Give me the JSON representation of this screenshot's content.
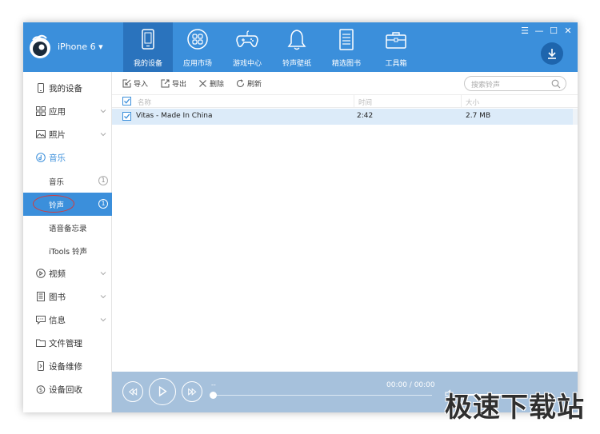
{
  "header": {
    "device_name": "iPhone 6 ▾",
    "tabs": [
      {
        "label": "我的设备",
        "icon": "phone-icon",
        "active": true
      },
      {
        "label": "应用市场",
        "icon": "apps-icon",
        "active": false
      },
      {
        "label": "游戏中心",
        "icon": "gamepad-icon",
        "active": false
      },
      {
        "label": "铃声壁纸",
        "icon": "bell-icon",
        "active": false
      },
      {
        "label": "精选图书",
        "icon": "book-icon",
        "active": false
      },
      {
        "label": "工具箱",
        "icon": "toolbox-icon",
        "active": false
      }
    ],
    "window_controls": [
      "☰",
      "—",
      "☐",
      "✕"
    ],
    "accent": "#3b8fdb",
    "active_tab_bg": "#2a73bd"
  },
  "sidebar": {
    "items": [
      {
        "label": "我的设备",
        "icon": "device-icon"
      },
      {
        "label": "应用",
        "icon": "grid-icon",
        "expandable": true
      },
      {
        "label": "照片",
        "icon": "photo-icon",
        "expandable": true
      },
      {
        "label": "音乐",
        "icon": "music-icon",
        "expanded": true
      },
      {
        "label": "音乐",
        "sub": true,
        "badge": "1"
      },
      {
        "label": "铃声",
        "sub": true,
        "badge": "1",
        "active": true
      },
      {
        "label": "语音备忘录",
        "sub": true
      },
      {
        "label": "iTools 铃声",
        "sub": true
      },
      {
        "label": "视频",
        "icon": "video-icon",
        "expandable": true
      },
      {
        "label": "图书",
        "icon": "books-icon",
        "expandable": true
      },
      {
        "label": "信息",
        "icon": "message-icon",
        "expandable": true
      },
      {
        "label": "文件管理",
        "icon": "folder-icon"
      },
      {
        "label": "设备维修",
        "icon": "repair-icon"
      },
      {
        "label": "设备回收",
        "icon": "recycle-icon"
      }
    ]
  },
  "toolbar": {
    "import_label": "导入",
    "export_label": "导出",
    "delete_label": "删除",
    "refresh_label": "刷新",
    "search_placeholder": "搜索铃声"
  },
  "table": {
    "columns": [
      "名称",
      "时间",
      "大小"
    ],
    "rows": [
      {
        "name": "Vitas - Made In China",
        "time": "2:42",
        "size": "2.7 MB",
        "checked": true
      }
    ]
  },
  "player": {
    "track": "--",
    "time": "00:00 / 00:00",
    "progress": 0
  },
  "watermark": "极速下载站"
}
